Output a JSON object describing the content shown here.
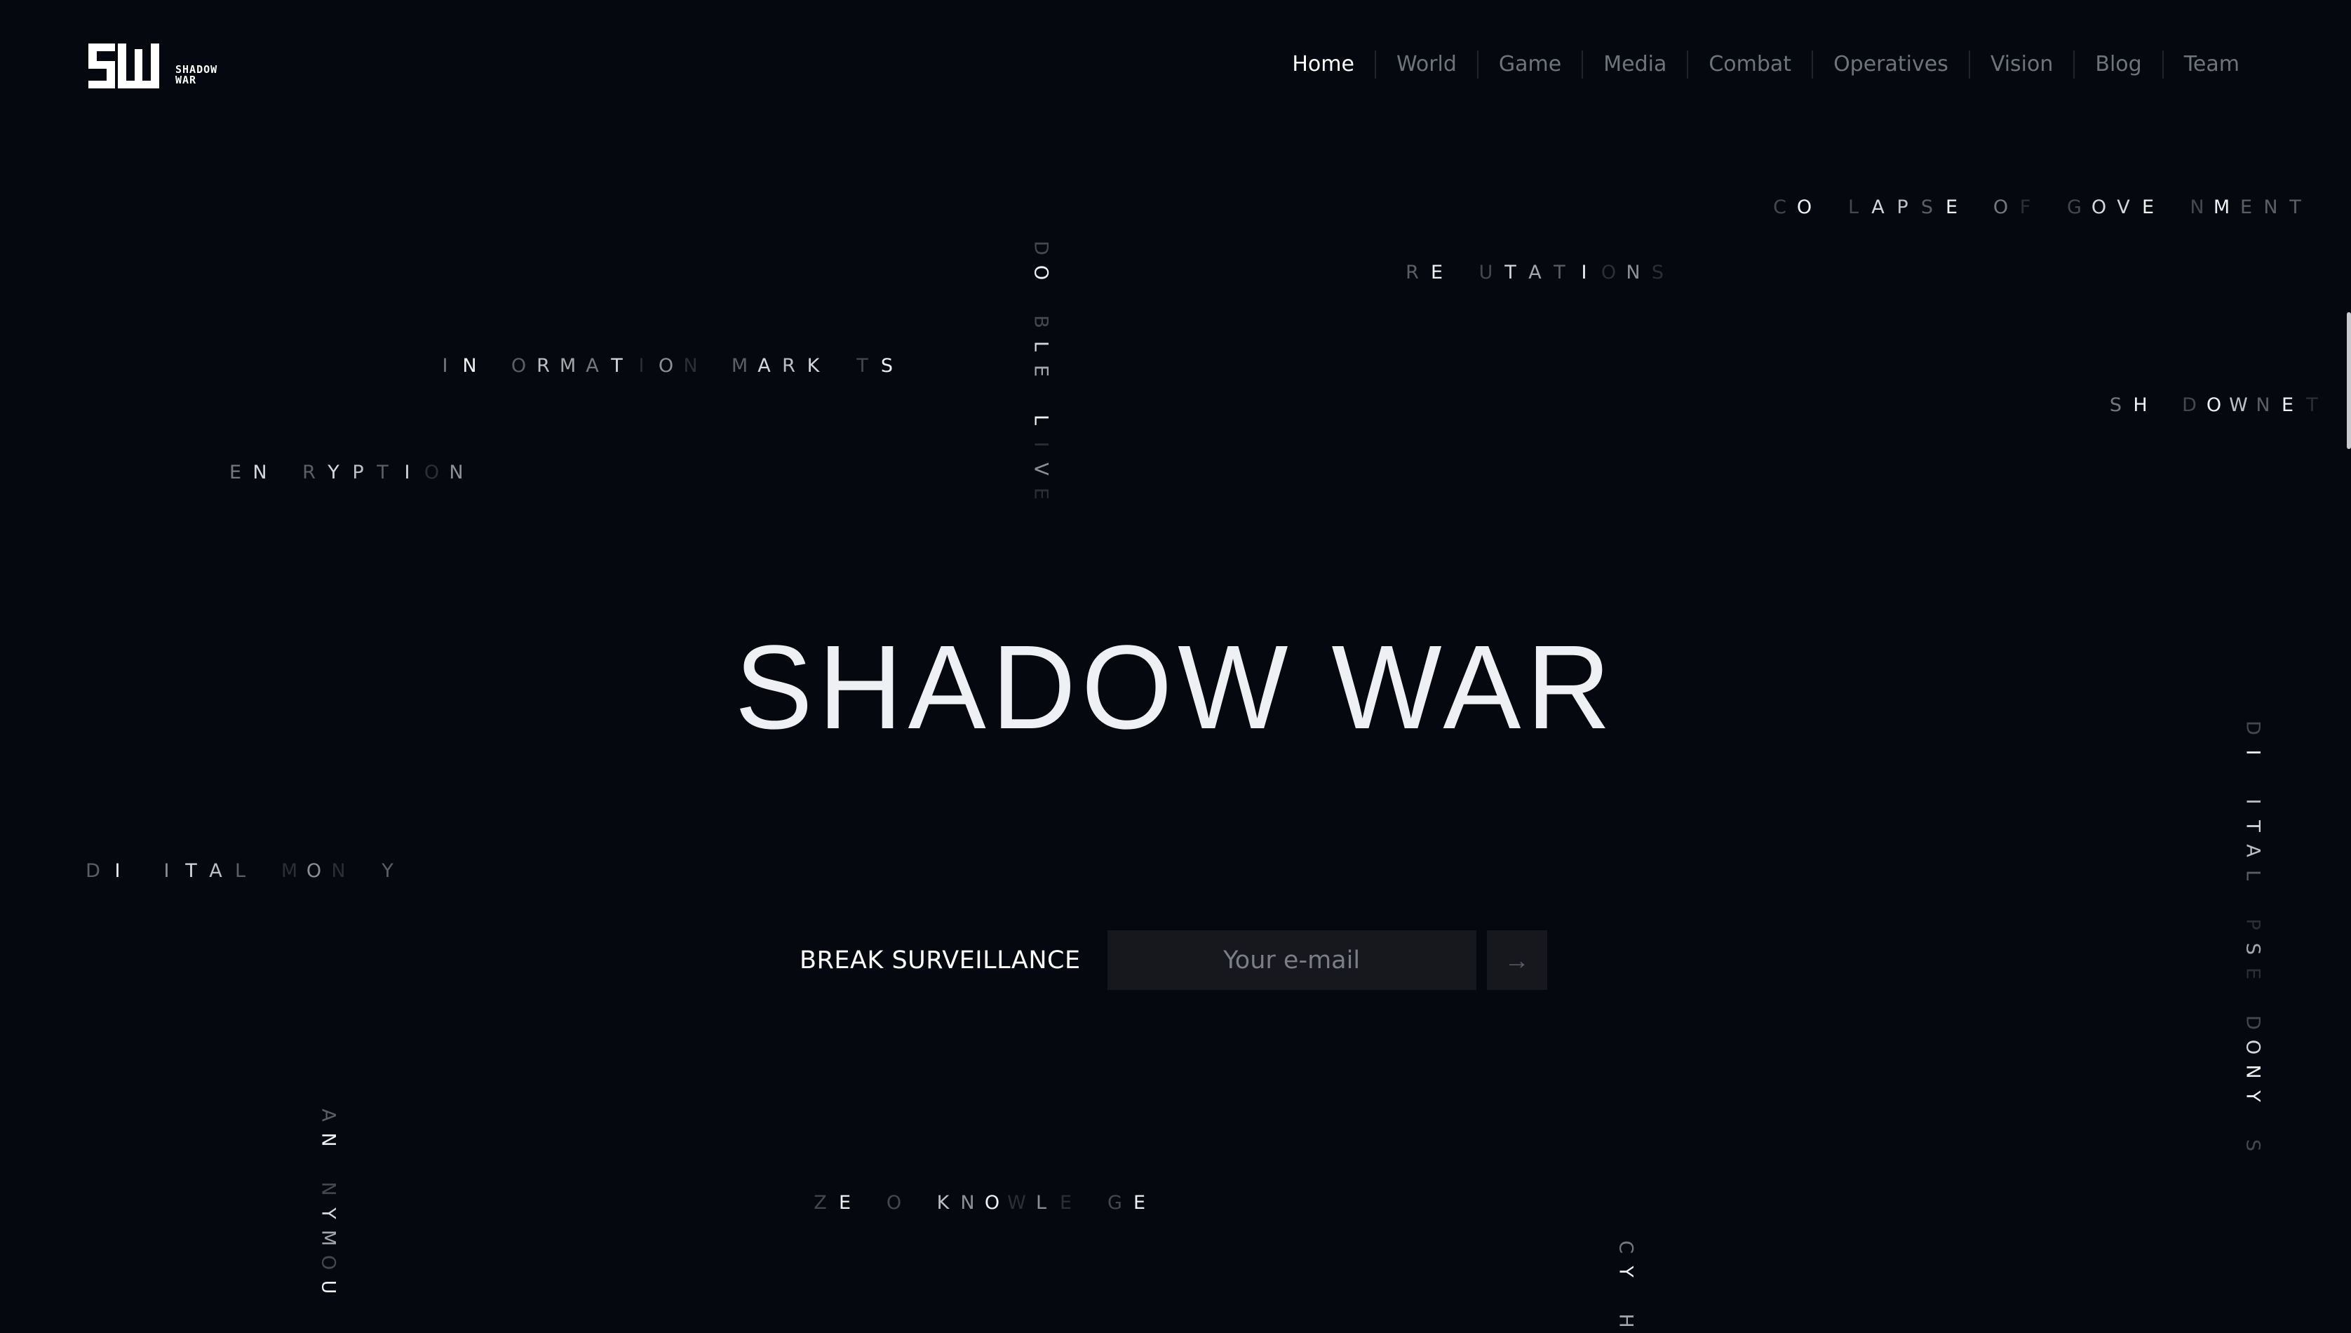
{
  "logo": {
    "mark": "SW",
    "text_line1": "SHADOW",
    "text_line2": "WAR"
  },
  "nav": {
    "items": [
      {
        "label": "Home",
        "active": true
      },
      {
        "label": "World"
      },
      {
        "label": "Game"
      },
      {
        "label": "Media"
      },
      {
        "label": "Combat"
      },
      {
        "label": "Operatives"
      },
      {
        "label": "Vision"
      },
      {
        "label": "Blog"
      },
      {
        "label": "Team"
      }
    ]
  },
  "floating_words": [
    {
      "id": "collapse",
      "letters": "CO LAPSE OF GOVE NMENT",
      "levels": "29028739041028890293339",
      "vertical": false
    },
    {
      "id": "reputations",
      "letters": "RE UTATIONS",
      "levels": "39028639151",
      "vertical": false
    },
    {
      "id": "shadownet",
      "letters": "SH DOWNET",
      "levels": "490297391",
      "vertical": false
    },
    {
      "id": "information",
      "letters": "IN ORMATION MARK TS",
      "levels": "4903764815103878029",
      "vertical": false
    },
    {
      "id": "encryption",
      "letters": "EN RYPTION",
      "levels": "4803873815",
      "vertical": false
    },
    {
      "id": "double-live",
      "letters": "DO BLE LIVE",
      "levels": "29028609151",
      "vertical": true
    },
    {
      "id": "digital-money",
      "letters": "DI ITAL MON Y",
      "levels": "3905873015103",
      "vertical": false
    },
    {
      "id": "digital-pseudonyms",
      "letters": "DI ITAL PSE DONY S",
      "levels": "290787301610289902",
      "vertical": true
    },
    {
      "id": "zero-knowledge",
      "letters": "ZE O KNOWLE GE",
      "levels": "29020759151029",
      "vertical": false
    },
    {
      "id": "anonymous",
      "letters": "AN NYMOU",
      "levels": "39028629",
      "vertical": true
    },
    {
      "id": "cypher",
      "letters": "CY H",
      "levels": "4906",
      "vertical": true
    }
  ],
  "hero": {
    "title": "SHADOW WAR"
  },
  "signup": {
    "label": "BREAK SURVEILLANCE",
    "email_placeholder": "Your e-mail",
    "email_value": "",
    "submit_icon": "arrow-right-icon",
    "submit_glyph": "→"
  },
  "colors": {
    "background": "#05080f",
    "text": "#f0f1f3",
    "nav_inactive": "#6f737b",
    "input_bg": "#16181d"
  }
}
